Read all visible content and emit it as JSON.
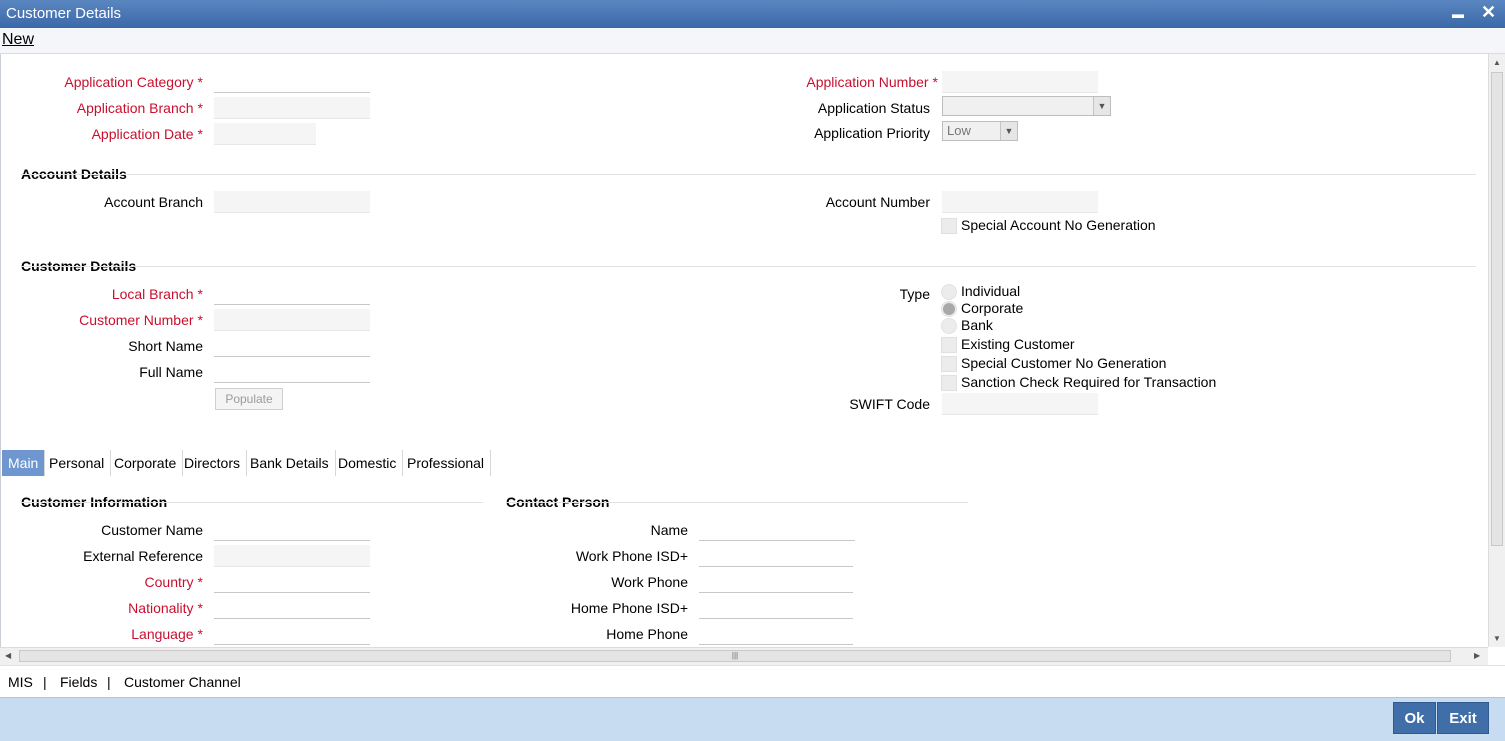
{
  "window": {
    "title": "Customer Details",
    "minimize": "▬",
    "close": "✕"
  },
  "menu": {
    "new": "New"
  },
  "app": {
    "category_label": "Application Category",
    "branch_label": "Application Branch",
    "date_label": "Application Date",
    "number_label": "Application Number",
    "status_label": "Application Status",
    "priority_label": "Application Priority",
    "priority_value": "Low",
    "required_mark": "*"
  },
  "account": {
    "section": "Account Details",
    "branch_label": "Account Branch",
    "number_label": "Account Number",
    "special_label": "Special Account No Generation"
  },
  "customer": {
    "section": "Customer Details",
    "local_branch_label": "Local Branch",
    "number_label": "Customer Number",
    "short_name_label": "Short Name",
    "full_name_label": "Full Name",
    "populate": "Populate",
    "type_label": "Type",
    "type_options": [
      "Individual",
      "Corporate",
      "Bank"
    ],
    "existing_label": "Existing Customer",
    "special_no_label": "Special Customer No Generation",
    "sanction_label": "Sanction Check Required for Transaction",
    "swift_label": "SWIFT Code"
  },
  "tabs": [
    "Main",
    "Personal",
    "Corporate",
    "Directors",
    "Bank Details",
    "Domestic",
    "Professional"
  ],
  "info": {
    "section": "Customer Information",
    "customer_name_label": "Customer Name",
    "external_ref_label": "External Reference",
    "country_label": "Country",
    "nationality_label": "Nationality",
    "language_label": "Language"
  },
  "contact": {
    "section": "Contact Person",
    "name_label": "Name",
    "work_isd_label": "Work Phone ISD+",
    "work_phone_label": "Work Phone",
    "home_isd_label": "Home Phone ISD+",
    "home_phone_label": "Home Phone"
  },
  "links": {
    "mis": "MIS",
    "sep": "|",
    "fields": "Fields",
    "channel": "Customer Channel"
  },
  "footer": {
    "ok": "Ok",
    "exit": "Exit"
  }
}
